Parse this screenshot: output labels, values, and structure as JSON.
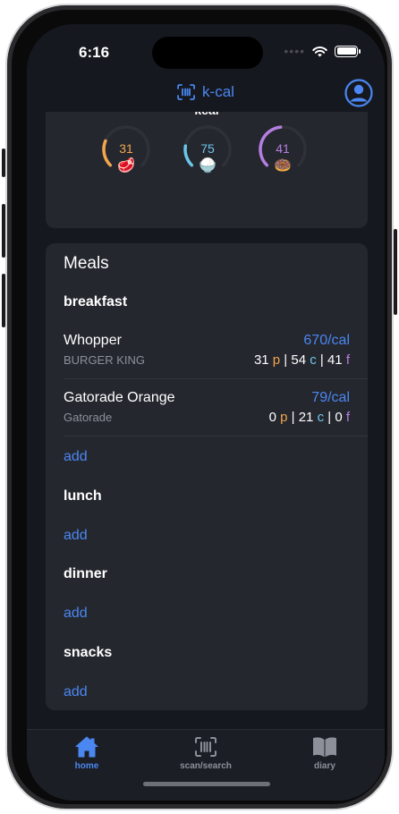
{
  "status_bar": {
    "time": "6:16",
    "signal": "••••",
    "icons": [
      "wifi-icon",
      "battery-icon"
    ]
  },
  "nav": {
    "title": "k-cal",
    "icons": {
      "scan": "barcode-scan-icon",
      "profile": "profile-icon"
    }
  },
  "summary": {
    "kcal_label": "kcal",
    "macros": [
      {
        "name": "protein",
        "value": "31",
        "emoji": "🥩",
        "color": "#f3a64c",
        "progress": 0.25
      },
      {
        "name": "carbs",
        "value": "75",
        "emoji": "🍚",
        "color": "#6cc6e8",
        "progress": 0.2
      },
      {
        "name": "fat",
        "value": "41",
        "emoji": "🍩",
        "color": "#b47fe0",
        "progress": 0.48
      }
    ]
  },
  "meals": {
    "title": "Meals",
    "add_label": "add",
    "sections": [
      {
        "name": "breakfast",
        "items": [
          {
            "name": "Whopper",
            "brand": "BURGER KING",
            "calories": "670/cal",
            "protein": "31",
            "carbs": "54",
            "fat": "41"
          },
          {
            "name": "Gatorade Orange",
            "brand": "Gatorade",
            "calories": "79/cal",
            "protein": "0",
            "carbs": "21",
            "fat": "0"
          }
        ]
      },
      {
        "name": "lunch",
        "items": []
      },
      {
        "name": "dinner",
        "items": []
      },
      {
        "name": "snacks",
        "items": []
      }
    ],
    "macro_letters": {
      "p": "p",
      "c": "c",
      "f": "f"
    }
  },
  "tabs": [
    {
      "label": "home",
      "icon": "home-icon",
      "active": true
    },
    {
      "label": "scan/search",
      "icon": "barcode-scan-icon",
      "active": false
    },
    {
      "label": "diary",
      "icon": "book-icon",
      "active": false
    }
  ],
  "colors": {
    "accent": "#4a87f0",
    "background": "#16181f",
    "card": "#25272f",
    "protein": "#f3a64c",
    "carbs": "#6cc6e8",
    "fat": "#b47fe0",
    "inactive_tab": "#8d9099"
  }
}
